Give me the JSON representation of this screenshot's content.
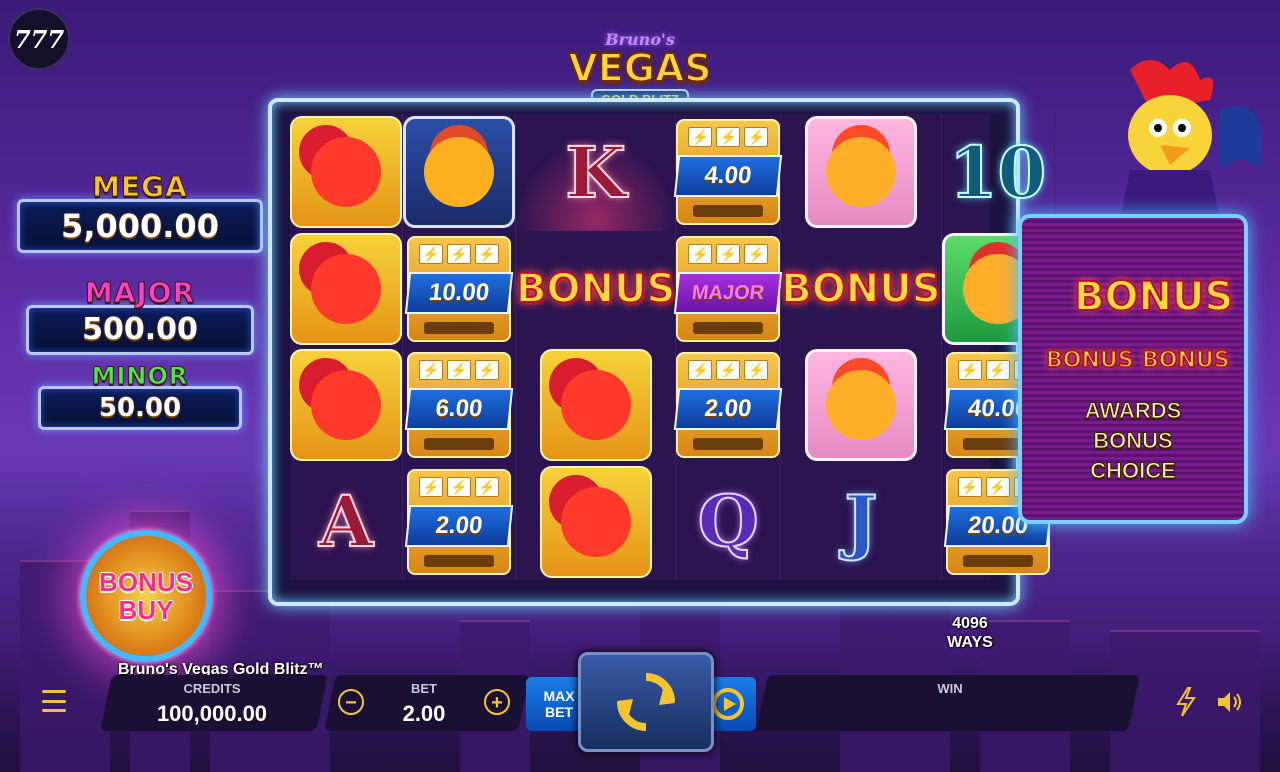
{
  "brand_logo": "777",
  "game_title": "Bruno's Vegas Gold Blitz™",
  "game_logo": {
    "line1": "Bruno's",
    "line2": "VEGAS",
    "line3": "GOLD BLITZ"
  },
  "jackpots": [
    {
      "name": "MEGA",
      "amount": "5,000.00",
      "color": "#f5c62a"
    },
    {
      "name": "MAJOR",
      "amount": "500.00",
      "color": "#ff3fc8"
    },
    {
      "name": "MINOR",
      "amount": "50.00",
      "color": "#4ee84e"
    }
  ],
  "bonus_buy": {
    "line1": "BONUS",
    "line2": "BUY"
  },
  "reel_values": {
    "r0c1": "4.00",
    "r1c1": "10.00",
    "r1c3": "MAJOR",
    "r2c1": "6.00",
    "r2c3": "2.00",
    "r2c5": "40.00",
    "r3c1": "2.00",
    "r3c5": "20.00"
  },
  "card_symbols": {
    "k": "K",
    "ten": "10",
    "a": "A",
    "q": "Q",
    "j": "J"
  },
  "bonus_symbol": "BONUS",
  "ways": {
    "count": "4096",
    "label": "WAYS"
  },
  "right_panel": {
    "bonus": "BONUS",
    "line1": "AWARDS",
    "line2": "BONUS",
    "line3": "CHOICE"
  },
  "bottom_bar": {
    "credits_label": "CREDITS",
    "credits_value": "100,000.00",
    "bet_label": "BET",
    "bet_value": "2.00",
    "max_bet_line1": "MAX",
    "max_bet_line2": "BET",
    "win_label": "WIN",
    "win_value": ""
  },
  "icons": {
    "menu": "menu-icon",
    "minus": "minus-icon",
    "plus": "plus-icon",
    "spin": "spin-icon",
    "autoplay": "autoplay-icon",
    "turbo": "lightning-icon",
    "sound": "speaker-icon"
  }
}
